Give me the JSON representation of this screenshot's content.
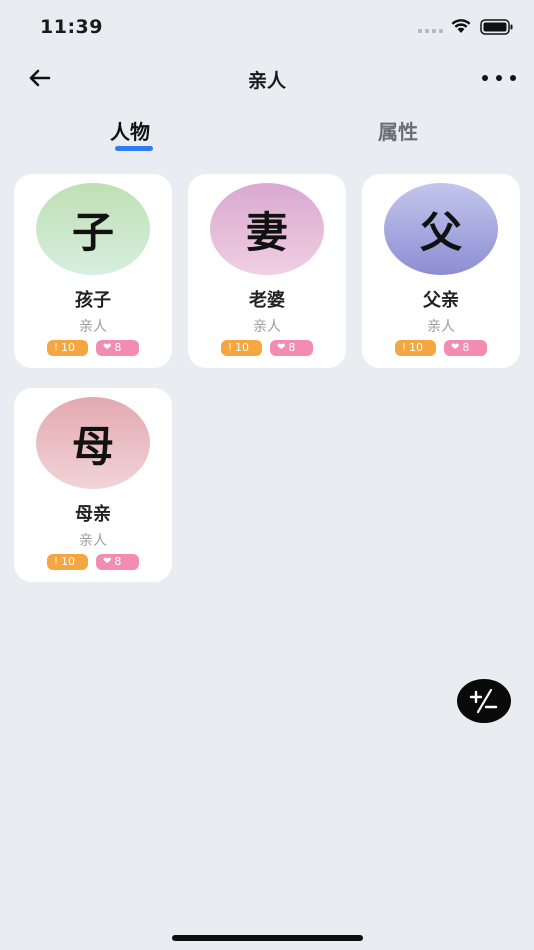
{
  "status": {
    "time": "11:39"
  },
  "nav": {
    "title": "亲人"
  },
  "tabs": [
    {
      "label": "人物",
      "active": true
    },
    {
      "label": "属性",
      "active": false
    }
  ],
  "colors": {
    "accent": "#2f7bf5",
    "badge_warn": "#f4a740",
    "badge_heart": "#f28cb0",
    "background": "#e9edf1"
  },
  "cards": [
    {
      "glyph": "子",
      "name": "孩子",
      "relation": "亲人",
      "stat_count": "10",
      "like_count": "8",
      "avatar_gradient": [
        "#bfe0b3",
        "#d6eee0"
      ]
    },
    {
      "glyph": "妻",
      "name": "老婆",
      "relation": "亲人",
      "stat_count": "10",
      "like_count": "8",
      "avatar_gradient": [
        "#d9a8cf",
        "#f0cfe3"
      ]
    },
    {
      "glyph": "父",
      "name": "父亲",
      "relation": "亲人",
      "stat_count": "10",
      "like_count": "8",
      "avatar_gradient": [
        "#c4c6ec",
        "#8c8ed4"
      ]
    },
    {
      "glyph": "母",
      "name": "母亲",
      "relation": "亲人",
      "stat_count": "10",
      "like_count": "8",
      "avatar_gradient": [
        "#e4a8b0",
        "#f0d4d8"
      ]
    }
  ],
  "fab": {
    "icon": "plus-minus-icon"
  }
}
